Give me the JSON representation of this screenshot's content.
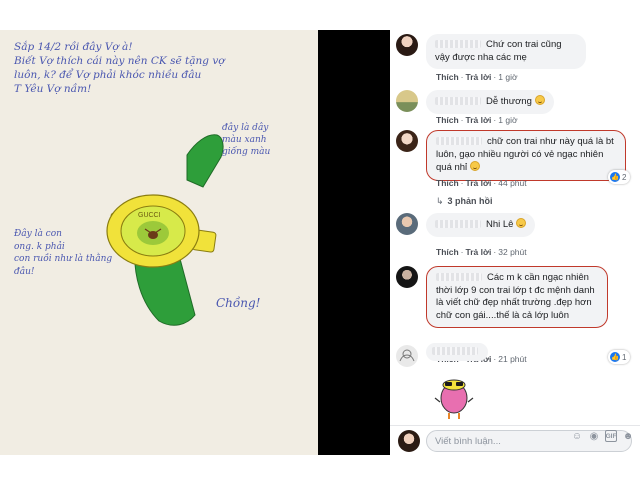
{
  "note": {
    "main_text": "Sắp 14/2 rồi đây Vợ à!\nBiết Vợ thích cái này nên CK sẽ tặng vợ\nluôn, k? để Vợ phải khóc nhiều đâu\nT Yêu Vợ nầm!",
    "annotation_right": "đây là dây\nmàu xanh\ngiống màu",
    "annotation_left": "Đây là con\nong. k phải\ncon ruồi như là thằng\nđâu!",
    "signature": "Chồng!",
    "watch_brand": "GUCCI"
  },
  "comments": [
    {
      "text": "Chứ con trai cũng vậy được nha các mẹ",
      "like_label": "Thích",
      "reply_label": "Trả lời",
      "time": "1 giờ"
    },
    {
      "text": "Dễ thương",
      "like_label": "Thích",
      "reply_label": "Trả lời",
      "time": "1 giờ"
    },
    {
      "text": "chữ con trai như này quá là bt luôn, gạo nhiều người có vẻ ngạc nhiên quá nhỉ",
      "like_label": "Thích",
      "reply_label": "Trả lời",
      "time": "44 phút",
      "reactions": "2",
      "reply_count": "3 phản hồi"
    },
    {
      "text": "Nhi Lê",
      "like_label": "Thích",
      "reply_label": "Trả lời",
      "time": "32 phút"
    },
    {
      "text": "Các m k cần ngạc nhiên thời lớp 9 con trai lớp t đc mệnh danh là viết chữ đẹp nhất trường .đẹp hơn chữ con gái....thế là cả lớp luôn",
      "like_label": "Thích",
      "reply_label": "Trả lời",
      "time": "21 phút",
      "reactions": "1"
    }
  ],
  "composer": {
    "placeholder": "Viết bình luận..."
  },
  "colors": {
    "link": "#4b4f56",
    "like_blue": "#1877f2",
    "highlight_red": "#c0392b",
    "ink_blue": "#4a57b0",
    "watch_green": "#2e9e3a",
    "watch_yellow": "#f1e23a"
  }
}
